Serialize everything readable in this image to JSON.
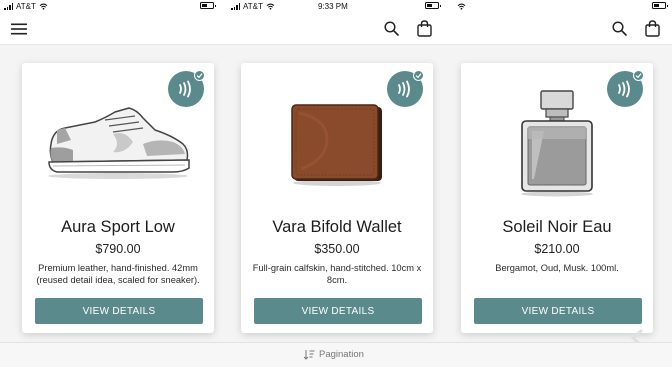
{
  "status_bar": {
    "panes": [
      {
        "carrier": "AT&T",
        "time": ""
      },
      {
        "carrier": "AT&T",
        "time": "9:33 PM"
      },
      {
        "carrier": "",
        "time": ""
      }
    ]
  },
  "nav": {
    "menu_icon": "hamburger-menu-icon",
    "search_icon": "search-icon",
    "bag_icon": "shopping-bag-icon"
  },
  "products": [
    {
      "title": "Aura Sport Low",
      "price": "$790.00",
      "description": "Premium leather, hand-finished. 42mm (reused detail idea, scaled for sneaker).",
      "button_label": "VIEW DETAILS",
      "image_icon": "sneaker-icon",
      "badge_icon": "nfc-verified-icon"
    },
    {
      "title": "Vara Bifold Wallet",
      "price": "$350.00",
      "description": "Full-grain calfskin, hand-stitched. 10cm x 8cm.",
      "button_label": "VIEW DETAILS",
      "image_icon": "wallet-icon",
      "badge_icon": "nfc-verified-icon"
    },
    {
      "title": "Soleil Noir Eau",
      "price": "$210.00",
      "description": "Bergamot, Oud, Musk. 100ml.",
      "button_label": "VIEW DETAILS",
      "image_icon": "perfume-bottle-icon",
      "badge_icon": "nfc-verified-icon"
    }
  ],
  "footer": {
    "pagination_label": "Pagination",
    "pagination_icon": "sort-list-icon"
  },
  "colors": {
    "accent": "#5b8a8c",
    "background": "#f4f4f4",
    "card": "#ffffff",
    "wallet_brown": "#8a4a2c"
  }
}
